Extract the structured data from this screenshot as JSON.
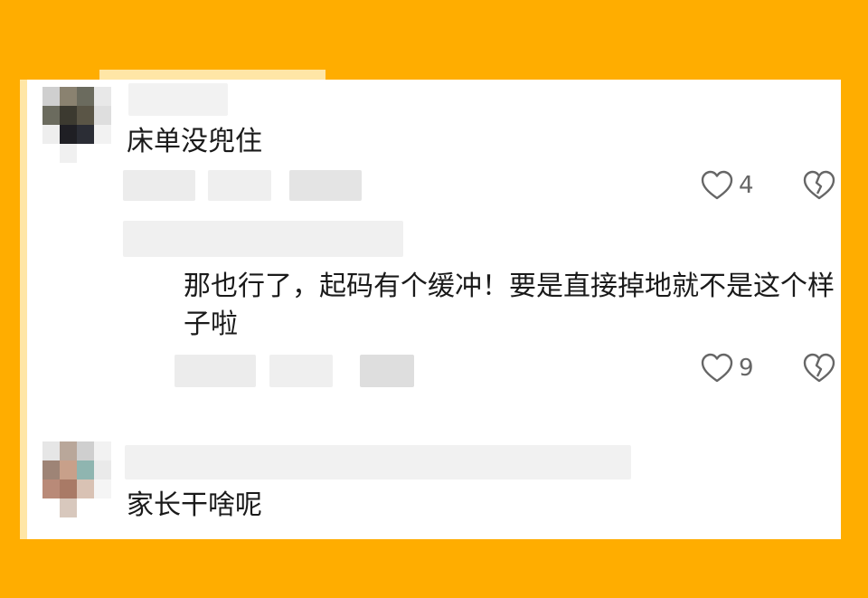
{
  "comments": [
    {
      "text": "床单没兜住",
      "like_count": "4",
      "reply": {
        "text": "那也行了，起码有个缓冲！要是直接掉地就不是这个样子啦",
        "like_count": "9"
      }
    },
    {
      "text": "家长干啥呢"
    }
  ],
  "colors": {
    "background": "#FFAD00",
    "card": "#FFFFFF",
    "accent_strip": "#FFE6A6",
    "text": "#1A1A1A",
    "icon": "#666666"
  },
  "icons": [
    "heart-outline-icon",
    "broken-heart-icon"
  ]
}
